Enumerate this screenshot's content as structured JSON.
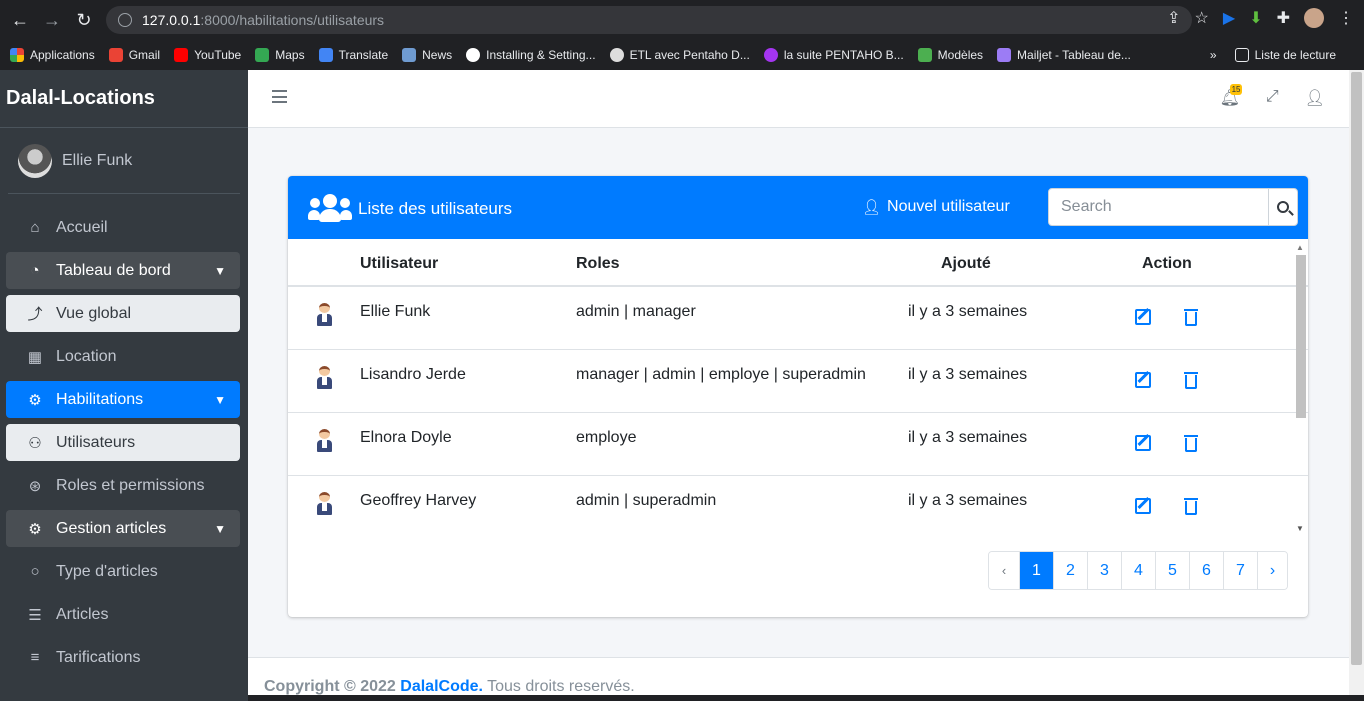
{
  "browser": {
    "url_host": "127.0.0.1",
    "url_path": ":8000/habilitations/utilisateurs",
    "bookmarks": [
      "Applications",
      "Gmail",
      "YouTube",
      "Maps",
      "Translate",
      "News",
      "Installing & Setting...",
      "ETL avec Pentaho D...",
      "la suite PENTAHO B...",
      "Modèles",
      "Mailjet - Tableau de..."
    ],
    "bookmark_more": "»",
    "reading_list": "Liste de lecture"
  },
  "sidebar": {
    "brand": "Dalal-Locations",
    "user_name": "Ellie Funk",
    "items": [
      {
        "label": "Accueil",
        "icon": "⌂"
      },
      {
        "label": "Tableau de bord",
        "icon": "◔"
      },
      {
        "label": "Vue global",
        "icon": "⤴"
      },
      {
        "label": "Location",
        "icon": "▦"
      },
      {
        "label": "Habilitations",
        "icon": "⚙"
      },
      {
        "label": "Utilisateurs",
        "icon": "⚇"
      },
      {
        "label": "Roles et permissions",
        "icon": "⊛"
      },
      {
        "label": "Gestion articles",
        "icon": "⚙"
      },
      {
        "label": "Type d'articles",
        "icon": "○"
      },
      {
        "label": "Articles",
        "icon": "☰"
      },
      {
        "label": "Tarifications",
        "icon": "≡"
      }
    ]
  },
  "topbar": {
    "notif_count": "15"
  },
  "card": {
    "title": "Liste des utilisateurs",
    "new_user": "Nouvel utilisateur",
    "search_placeholder": "Search",
    "headers": {
      "user": "Utilisateur",
      "roles": "Roles",
      "added": "Ajouté",
      "action": "Action"
    },
    "rows": [
      {
        "name": "Ellie Funk",
        "roles": "admin | manager",
        "added": "il y a 3 semaines"
      },
      {
        "name": "Lisandro Jerde",
        "roles": "manager | admin | employe | superadmin",
        "added": "il y a 3 semaines"
      },
      {
        "name": "Elnora Doyle",
        "roles": "employe",
        "added": "il y a 3 semaines"
      },
      {
        "name": "Geoffrey Harvey",
        "roles": "admin | superadmin",
        "added": "il y a 3 semaines"
      }
    ],
    "pagination": [
      "‹",
      "1",
      "2",
      "3",
      "4",
      "5",
      "6",
      "7",
      "›"
    ]
  },
  "footer": {
    "prefix": "Copyright © 2022 ",
    "link": "DalalCode.",
    "suffix": " Tous droits reservés."
  },
  "colors": {
    "primary": "#007bff",
    "sidebar": "#343a40"
  }
}
